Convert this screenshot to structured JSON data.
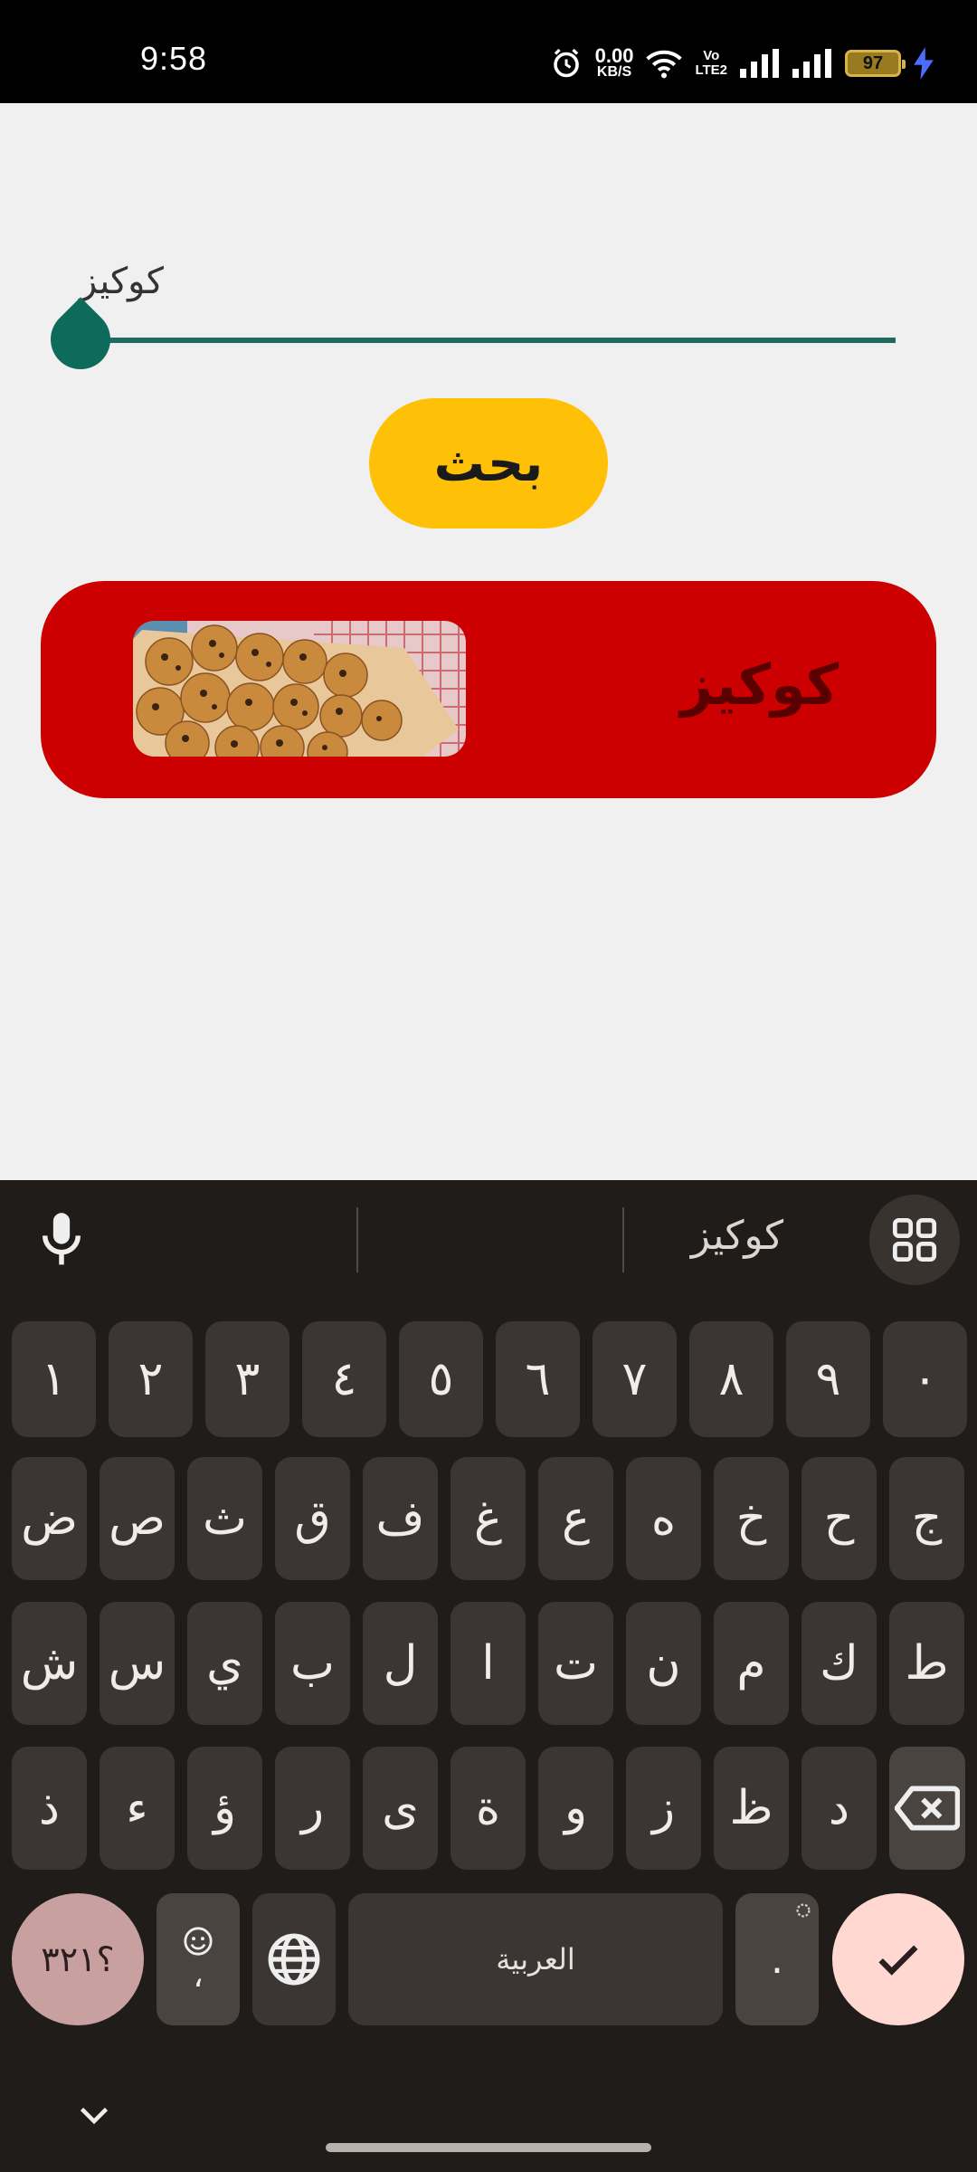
{
  "status_bar": {
    "time": "9:58",
    "net_speed_value": "0.00",
    "net_speed_unit": "KB/S",
    "volte_top": "Vo",
    "volte_bottom": "LTE2",
    "battery": "97",
    "battery_color": "#d8b348",
    "charging_color": "#4a6cff"
  },
  "search": {
    "value": "كوكيز",
    "button_label": "بحث",
    "accent_color": "#1f6b5f",
    "button_color": "#ffc107"
  },
  "results": [
    {
      "title": "كوكيز",
      "card_color": "#cc0000"
    }
  ],
  "keyboard": {
    "suggestion": "كوكيز",
    "number_row": [
      "١",
      "٢",
      "٣",
      "٤",
      "٥",
      "٦",
      "٧",
      "٨",
      "٩",
      "٠"
    ],
    "row2": [
      "ض",
      "ص",
      "ث",
      "ق",
      "ف",
      "غ",
      "ع",
      "ه",
      "خ",
      "ح",
      "ج"
    ],
    "row3": [
      "ش",
      "س",
      "ي",
      "ب",
      "ل",
      "ا",
      "ت",
      "ن",
      "م",
      "ك",
      "ط"
    ],
    "row4": [
      "ذ",
      "ء",
      "ؤ",
      "ر",
      "ى",
      "ة",
      "و",
      "ز",
      "ظ",
      "د"
    ],
    "symbols_label": "؟٣٢١",
    "comma_label": "،",
    "space_label": "العربية",
    "period_label": "."
  }
}
